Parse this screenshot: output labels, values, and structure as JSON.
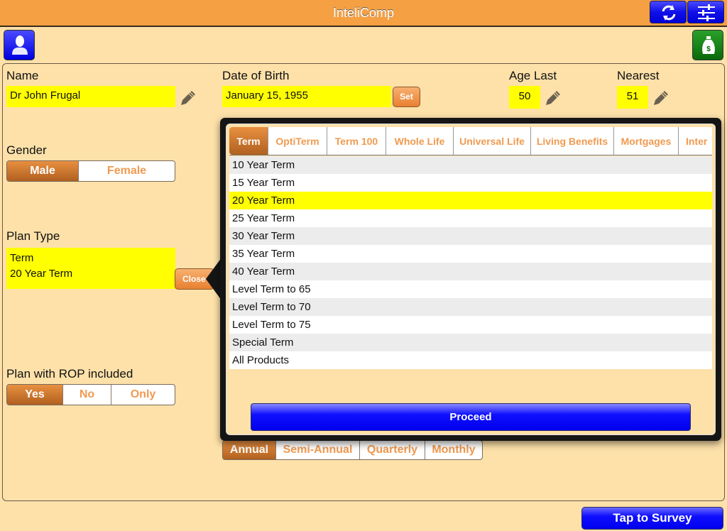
{
  "app": {
    "title": "InteliComp"
  },
  "toolbar": {
    "refresh_icon": "refresh-icon",
    "settings_icon": "sliders-icon",
    "profile_icon": "person-icon",
    "money_icon": "money-bag-icon"
  },
  "form": {
    "name_label": "Name",
    "name_value": "Dr John Frugal",
    "dob_label": "Date of Birth",
    "dob_value": "January 15, 1955",
    "set_label": "Set",
    "age_last_label": "Age Last",
    "age_last_value": "50",
    "nearest_label": "Nearest",
    "nearest_value": "51",
    "gender_label": "Gender",
    "gender_options": [
      "Male",
      "Female"
    ],
    "gender_selected": "Male",
    "plan_type_label": "Plan Type",
    "plan_type_line1": "Term",
    "plan_type_line2": "20 Year Term",
    "close_label": "Close",
    "rop_label": "Plan with ROP included",
    "rop_options": [
      "Yes",
      "No",
      "Only"
    ],
    "rop_selected": "Yes",
    "frequency_options": [
      "Annual",
      "Semi-Annual",
      "Quarterly",
      "Monthly"
    ],
    "frequency_selected": "Annual"
  },
  "popover": {
    "tabs": [
      "Term",
      "OptiTerm",
      "Term 100",
      "Whole Life",
      "Universal Life",
      "Living Benefits",
      "Mortgages",
      "Inter"
    ],
    "active_tab": "Term",
    "items": [
      "10 Year Term",
      "15 Year Term",
      "20 Year Term",
      "25 Year Term",
      "30 Year Term",
      "35 Year Term",
      "40 Year Term",
      "Level Term to 65",
      "Level Term to 70",
      "Level Term to 75",
      "Special Term",
      "All Products"
    ],
    "selected_item": "20 Year Term",
    "proceed_label": "Proceed"
  },
  "footer": {
    "survey_label": "Tap to Survey"
  },
  "colors": {
    "header": "#f5a043",
    "background": "#fde1a9",
    "highlight": "#ffff00",
    "accent_orange": "#f09a50",
    "button_blue": "#0000ee"
  }
}
